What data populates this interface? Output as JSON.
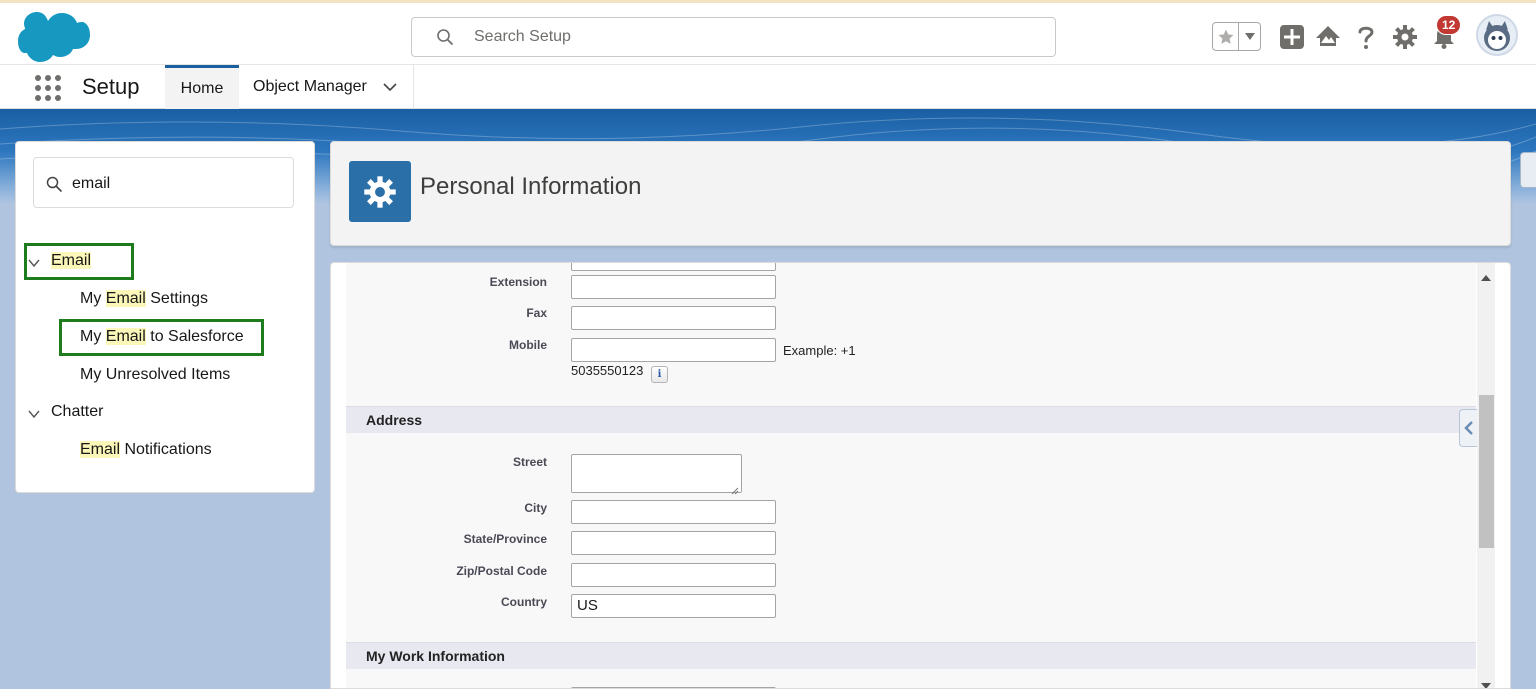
{
  "header": {
    "search_placeholder": "Search Setup",
    "notification_count": "12",
    "icons": [
      "salesforce-cloud-logo",
      "favorites-star-icon",
      "favorites-dropdown-icon",
      "global-actions-plus-icon",
      "trailhead-icon",
      "help-icon",
      "setup-gear-icon",
      "notifications-bell-icon",
      "user-avatar"
    ]
  },
  "nav": {
    "app_name": "Setup",
    "tabs": [
      {
        "label": "Home",
        "active": true
      },
      {
        "label": "Object Manager",
        "has_menu": true
      }
    ]
  },
  "sidebar": {
    "quickfind_value": "email",
    "groups": [
      {
        "label": "Email",
        "highlight": "Email",
        "items": [
          {
            "pre": "My ",
            "hl": "Email",
            "post": " Settings"
          },
          {
            "pre": "My ",
            "hl": "Email",
            "post": " to Salesforce"
          },
          {
            "pre": "My Unresolved Items",
            "hl": "",
            "post": ""
          }
        ]
      },
      {
        "label": "Chatter",
        "items": [
          {
            "pre": "",
            "hl": "Email",
            "post": " Notifications"
          }
        ]
      }
    ]
  },
  "page": {
    "title": "Personal Information"
  },
  "form": {
    "extension_label": "Extension",
    "fax_label": "Fax",
    "mobile_label": "Mobile",
    "mobile_example": "Example: +1",
    "mobile_example_number": "5035550123",
    "info_icon": "i",
    "address_section": "Address",
    "street_label": "Street",
    "city_label": "City",
    "state_label": "State/Province",
    "zip_label": "Zip/Postal Code",
    "country_label": "Country",
    "country_value": "US",
    "work_section": "My Work Information"
  },
  "colors": {
    "brand_blue": "#1b5f9e",
    "highlight_box": "#1e7b1e",
    "search_highlight": "#fbf7b8",
    "notification_badge": "#c23934"
  }
}
